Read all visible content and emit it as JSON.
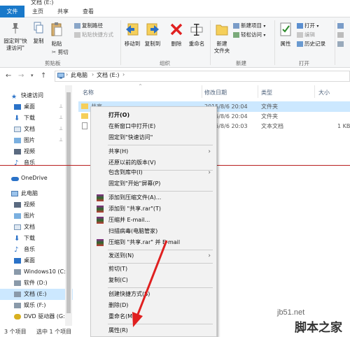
{
  "window": {
    "title": "文档 (E:)"
  },
  "ribbon": {
    "tabs": [
      "文件",
      "主页",
      "共享",
      "查看"
    ],
    "clipboard": {
      "pin": "固定到\"快\n速访问\"",
      "copy": "复制",
      "paste": "粘贴",
      "copy_path": "复制路径",
      "paste_shortcut": "粘贴快捷方式",
      "cut": "剪切",
      "group": "剪贴板"
    },
    "organize": {
      "move_to": "移动到",
      "copy_to": "复制到",
      "delete": "删除",
      "rename": "重命名",
      "group": "组织"
    },
    "new": {
      "new_folder": "新建\n文件夹",
      "new_item": "新建项目",
      "easy_access": "轻松访问",
      "group": "新建"
    },
    "open": {
      "properties": "属性",
      "open": "打开",
      "edit": "编辑",
      "history": "历史记录",
      "group": "打开"
    }
  },
  "address": {
    "crumbs": [
      "此电脑",
      "文档 (E:)"
    ]
  },
  "nav": {
    "items": [
      {
        "label": "快速访问",
        "icon": "star-icon",
        "pinned": false
      },
      {
        "label": "桌面",
        "icon": "desktop-icon",
        "pinned": true
      },
      {
        "label": "下载",
        "icon": "download-icon",
        "pinned": true
      },
      {
        "label": "文档",
        "icon": "document-icon",
        "pinned": true
      },
      {
        "label": "图片",
        "icon": "picture-icon",
        "pinned": true
      },
      {
        "label": "视频",
        "icon": "video-icon",
        "pinned": false
      },
      {
        "label": "音乐",
        "icon": "music-icon",
        "pinned": false
      },
      {
        "label": "OneDrive",
        "icon": "cloud-icon",
        "pinned": false
      },
      {
        "label": "此电脑",
        "icon": "computer-icon",
        "pinned": false
      },
      {
        "label": "视频",
        "icon": "video-icon",
        "pinned": false
      },
      {
        "label": "图片",
        "icon": "picture-icon",
        "pinned": false
      },
      {
        "label": "文档",
        "icon": "document-icon",
        "pinned": false
      },
      {
        "label": "下载",
        "icon": "download-icon",
        "pinned": false
      },
      {
        "label": "音乐",
        "icon": "music-icon",
        "pinned": false
      },
      {
        "label": "桌面",
        "icon": "desktop-icon",
        "pinned": false
      },
      {
        "label": "Windows10 (C:",
        "icon": "drive-icon",
        "pinned": false
      },
      {
        "label": "软件 (D:)",
        "icon": "drive-icon",
        "pinned": false
      },
      {
        "label": "文档 (E:)",
        "icon": "drive-icon",
        "pinned": false
      },
      {
        "label": "娱乐 (F:)",
        "icon": "drive-icon",
        "pinned": false
      },
      {
        "label": "DVD 驱动器 (G:",
        "icon": "dvd-icon",
        "pinned": false
      }
    ]
  },
  "files": {
    "columns": [
      "名称",
      "修改日期",
      "类型",
      "大小"
    ],
    "rows": [
      {
        "name": "共享",
        "date": "2015/8/6 20:04",
        "type": "文件夹",
        "size": ""
      },
      {
        "name": "",
        "date": "2015/8/6 20:04",
        "type": "文件夹",
        "size": ""
      },
      {
        "name": "",
        "date": "2015/8/6 20:03",
        "type": "文本文档",
        "size": "1 KB"
      }
    ]
  },
  "status": {
    "count": "3 个项目",
    "selected": "选中 1 个项目"
  },
  "context_menu": {
    "items": [
      {
        "label": "打开(O)",
        "bold": true
      },
      {
        "label": "在新窗口中打开(E)"
      },
      {
        "label": "固定到\"快速访问\""
      },
      {
        "sep": true
      },
      {
        "label": "共享(H)",
        "submenu": true
      },
      {
        "label": "还原以前的版本(V)"
      },
      {
        "sep": true
      },
      {
        "label": "包含到库中(I)",
        "submenu": true
      },
      {
        "label": "固定到\"开始\"屏幕(P)"
      },
      {
        "sep": true
      },
      {
        "label": "添加到压缩文件(A)...",
        "rar": true
      },
      {
        "label": "添加到 \"共享.rar\"(T)",
        "rar": true
      },
      {
        "label": "压缩并 E-mail...",
        "rar": true
      },
      {
        "label": "扫描病毒(电脑管家)"
      },
      {
        "label": "压缩到 \"共享.rar\" 并 E-mail",
        "rar": true
      },
      {
        "sep": true
      },
      {
        "label": "发送到(N)",
        "submenu": true
      },
      {
        "sep": true
      },
      {
        "label": "剪切(T)"
      },
      {
        "label": "复制(C)"
      },
      {
        "sep": true
      },
      {
        "label": "创建快捷方式(S)"
      },
      {
        "label": "删除(D)"
      },
      {
        "label": "重命名(M)"
      },
      {
        "sep": true
      },
      {
        "label": "属性(R)"
      }
    ]
  },
  "watermark": {
    "site": "jb51.net",
    "brand": "脚本之家"
  },
  "colors": {
    "accent": "#1979ca",
    "selection": "#cce8ff",
    "annotation": "#e02020"
  }
}
